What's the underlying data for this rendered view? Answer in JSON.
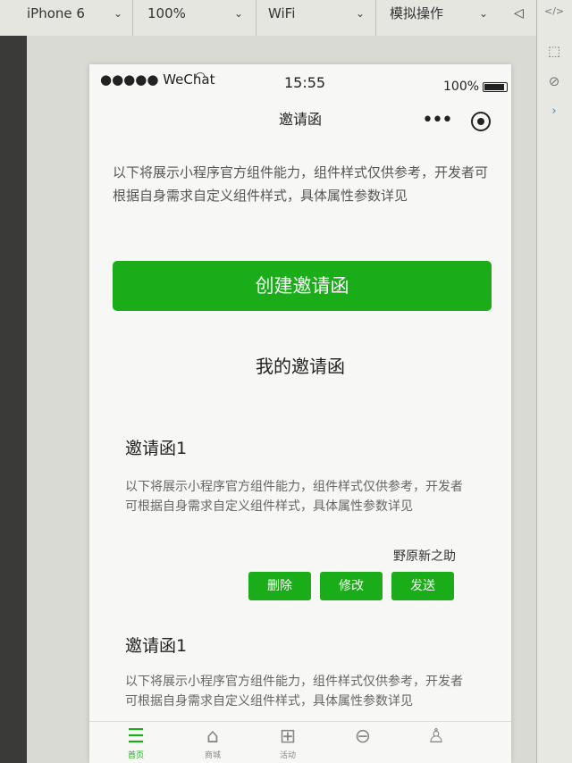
{
  "devtools": {
    "device": "iPhone 6",
    "zoom": "100%",
    "network": "WiFi",
    "simulate": "模拟操作"
  },
  "statusbar": {
    "carrier": "●●●●● WeChat",
    "time": "15:55",
    "battery": "100%"
  },
  "navbar": {
    "title": "邀请函"
  },
  "intro_text": "以下将展示小程序官方组件能力，组件样式仅供参考，开发者可根据自身需求自定义组件样式，具体属性参数详见",
  "create_button": "创建邀请函",
  "section_title": "我的邀请函",
  "cards": [
    {
      "title": "邀请函1",
      "desc": "以下将展示小程序官方组件能力，组件样式仅供参考，开发者可根据自身需求自定义组件样式，具体属性参数详见",
      "author": "野原新之助",
      "buttons": {
        "delete": "删除",
        "edit": "修改",
        "send": "发送"
      }
    },
    {
      "title": "邀请函1",
      "desc": "以下将展示小程序官方组件能力，组件样式仅供参考，开发者可根据自身需求自定义组件样式，具体属性参数详见"
    }
  ],
  "tabbar": [
    {
      "icon": "list-icon",
      "label": "首页",
      "active": true
    },
    {
      "icon": "shop-icon",
      "label": "商城"
    },
    {
      "icon": "gift-icon",
      "label": "活动"
    },
    {
      "icon": "message-icon",
      "label": ""
    },
    {
      "icon": "user-icon",
      "label": ""
    }
  ],
  "colors": {
    "accent": "#1aad19"
  }
}
